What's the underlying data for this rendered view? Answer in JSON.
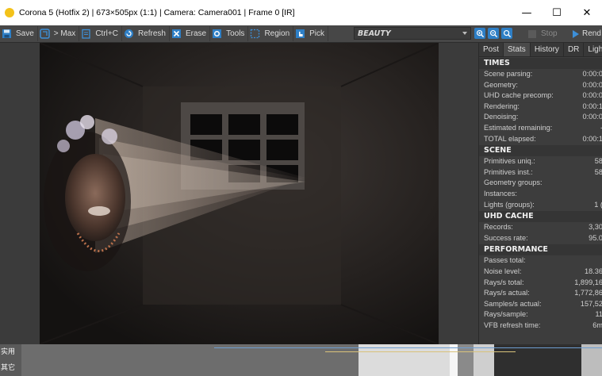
{
  "window": {
    "title": "Corona 5 (Hotfix 2) | 673×505px (1:1) | Camera: Camera001 | Frame 0 [IR]",
    "minimize": "—",
    "maximize": "☐",
    "close": "✕"
  },
  "toolbar": {
    "save": "Save",
    "max": "> Max",
    "ctrlc": "Ctrl+C",
    "refresh": "Refresh",
    "erase": "Erase",
    "tools": "Tools",
    "region": "Region",
    "pick": "Pick",
    "channel": "BEAUTY",
    "stop": "Stop",
    "render": "Rend"
  },
  "tabs": [
    "Post",
    "Stats",
    "History",
    "DR",
    "LightM"
  ],
  "stats": {
    "times": {
      "header": "TIMES",
      "rows": [
        {
          "label": "Scene parsing:",
          "value": "0:00:0"
        },
        {
          "label": "Geometry:",
          "value": "0:00:0"
        },
        {
          "label": "UHD cache precomp:",
          "value": "0:00:0"
        },
        {
          "label": "Rendering:",
          "value": "0:00:1"
        },
        {
          "label": "Denoising:",
          "value": "0:00:0"
        },
        {
          "label": "Estimated remaining:",
          "value": "-"
        },
        {
          "label": "TOTAL elapsed:",
          "value": "0:00:1"
        }
      ]
    },
    "scene": {
      "header": "SCENE",
      "rows": [
        {
          "label": "Primitives uniq.:",
          "value": "58"
        },
        {
          "label": "Primitives inst.:",
          "value": "58"
        },
        {
          "label": "Geometry groups:",
          "value": ""
        },
        {
          "label": "Instances:",
          "value": ""
        },
        {
          "label": "Lights (groups):",
          "value": "1 ("
        }
      ]
    },
    "uhd": {
      "header": "UHD CACHE",
      "rows": [
        {
          "label": "Records:",
          "value": "3,30"
        },
        {
          "label": "Success rate:",
          "value": "95.0"
        }
      ]
    },
    "performance": {
      "header": "PERFORMANCE",
      "rows": [
        {
          "label": "Passes total:",
          "value": ""
        },
        {
          "label": "Noise level:",
          "value": "18.36"
        },
        {
          "label": "Rays/s total:",
          "value": "1,899,16"
        },
        {
          "label": "Rays/s actual:",
          "value": "1,772,86"
        },
        {
          "label": "Samples/s actual:",
          "value": "157,52"
        },
        {
          "label": "Rays/sample:",
          "value": "11"
        },
        {
          "label": "VFB refresh time:",
          "value": "6m"
        }
      ]
    }
  },
  "bottom": {
    "label1": "实用",
    "label2": "其它"
  },
  "colors": {
    "accent": "#2e7fc6",
    "panel": "#3d3d3d",
    "toolbar": "#474747"
  }
}
